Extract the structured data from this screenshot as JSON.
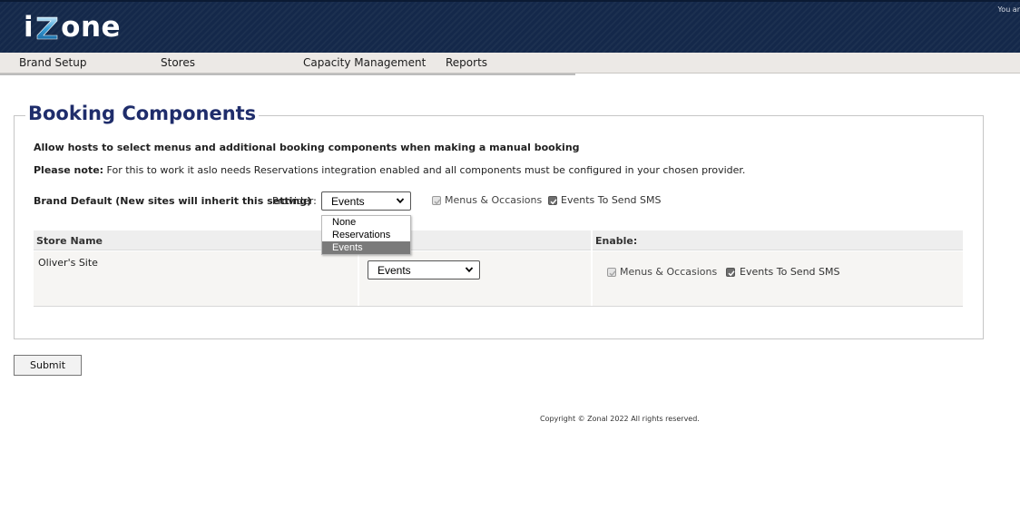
{
  "header": {
    "logo_prefix": "i",
    "logo_suffix": "one",
    "user_text": "You ar"
  },
  "nav": {
    "items": [
      {
        "label": "Brand Setup"
      },
      {
        "label": "Stores"
      },
      {
        "label": "Capacity Management"
      },
      {
        "label": "Reports"
      }
    ]
  },
  "page": {
    "title": "Booking Components",
    "description": "Allow hosts to select menus and additional booking components when making a manual booking",
    "note_label": "Please note:",
    "note_text": " For this to work it aslo needs Reservations integration enabled and all components must be configured in your chosen provider."
  },
  "brand_default": {
    "label": "Brand Default (New sites will inherit this setting)",
    "provider_label": "Provider:",
    "provider_value": "Events",
    "menus_label": "Menus & Occasions",
    "menus_checked": true,
    "menus_enabled": false,
    "sms_label": "Events To Send SMS",
    "sms_checked": true
  },
  "dropdown": {
    "options": [
      "None",
      "Reservations",
      "Events"
    ],
    "selected": "Events"
  },
  "table": {
    "headers": {
      "store_name": "Store Name",
      "enable": "Enable:"
    },
    "rows": [
      {
        "store_name": "Oliver's Site",
        "provider": "Events",
        "menus_label": "Menus & Occasions",
        "menus_checked": true,
        "sms_label": "Events To Send SMS",
        "sms_checked": true
      }
    ]
  },
  "actions": {
    "submit_label": "Submit"
  },
  "footer": {
    "copyright": "Copyright © Zonal 2022 All rights reserved."
  },
  "colors": {
    "header_bg": "#14284a",
    "title": "#1f2d6b",
    "nav_bg": "#ece9e6",
    "logo_z_accent": "#3ba0d8"
  }
}
